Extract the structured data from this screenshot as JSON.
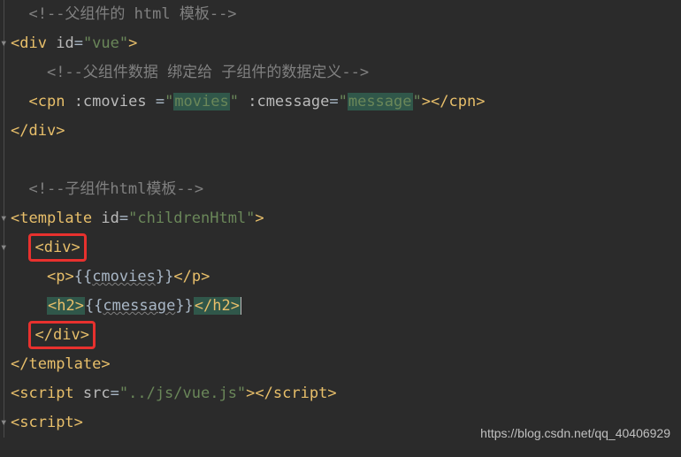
{
  "lines": {
    "c1": "<!--父组件的 html 模板-->",
    "l2_open": "<",
    "l2_tag": "div ",
    "l2_attr": "id",
    "l2_eq": "=",
    "l2_val": "\"vue\"",
    "l2_close": ">",
    "c3": "<!--父组件数据 绑定给 子组件的数据定义-->",
    "l4_open": "<",
    "l4_tag": "cpn ",
    "l4_attr1": ":cmovies ",
    "l4_eq1": "=",
    "l4_q1": "\"",
    "l4_v1": "movies",
    "l4_q1b": "\" ",
    "l4_attr2": ":cmessage",
    "l4_eq2": "=",
    "l4_q2": "\"",
    "l4_v2": "message",
    "l4_q2b": "\"",
    "l4_close": "></",
    "l4_tag2": "cpn",
    "l4_end": ">",
    "l5_open": "</",
    "l5_tag": "div",
    "l5_close": ">",
    "c7": "<!--子组件html模板-->",
    "l8_open": "<",
    "l8_tag": "template ",
    "l8_attr": "id",
    "l8_eq": "=",
    "l8_val": "\"childrenHtml\"",
    "l8_close": ">",
    "l9_open": "<",
    "l9_tag": "div",
    "l9_close": ">",
    "l10_open": "<",
    "l10_tag": "p",
    "l10_close1": ">",
    "l10_expr1": "{{",
    "l10_var": "cmovies",
    "l10_expr2": "}}",
    "l10_close2": "</",
    "l10_tag2": "p",
    "l10_close3": ">",
    "l11_open": "<",
    "l11_tag": "h2",
    "l11_close1": ">",
    "l11_expr1": "{{",
    "l11_var": "cmessage",
    "l11_expr2": "}}",
    "l11_close2": "</",
    "l11_tag2": "h2",
    "l11_close3": ">",
    "l12_open": "</",
    "l12_tag": "div",
    "l12_close": ">",
    "l13_open": "</",
    "l13_tag": "template",
    "l13_close": ">",
    "l14_open": "<",
    "l14_tag": "script ",
    "l14_attr": "src",
    "l14_eq": "=",
    "l14_val": "\"../js/vue.js\"",
    "l14_close": "></",
    "l14_tag2": "script",
    "l14_end": ">",
    "l15_open": "<",
    "l15_tag": "script",
    "l15_close": ">"
  },
  "watermark": "https://blog.csdn.net/qq_40406929"
}
